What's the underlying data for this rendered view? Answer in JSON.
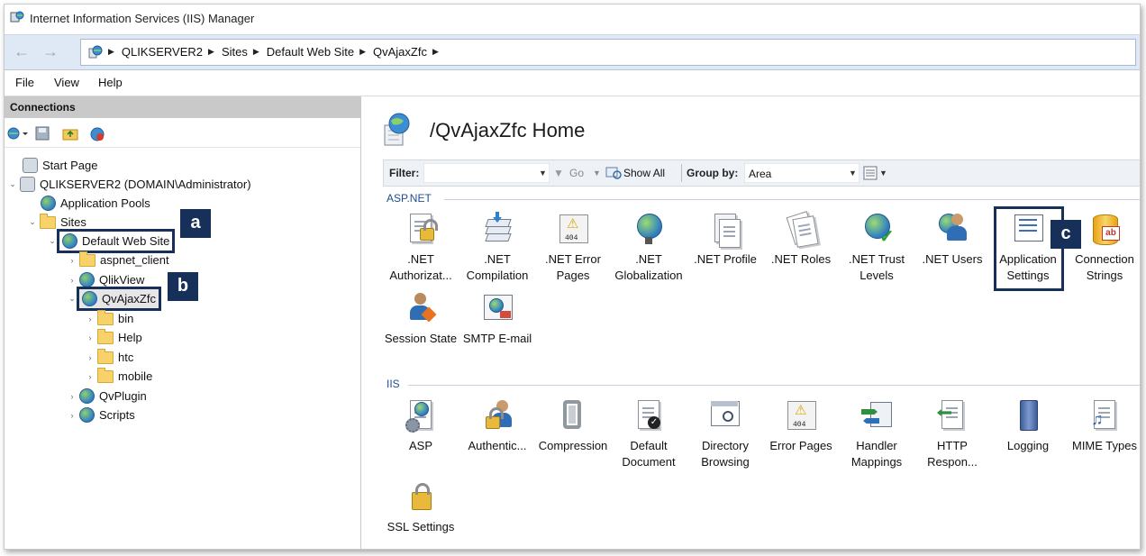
{
  "window": {
    "title": "Internet Information Services (IIS) Manager"
  },
  "address": {
    "crumbs": [
      "QLIKSERVER2",
      "Sites",
      "Default Web Site",
      "QvAjaxZfc"
    ]
  },
  "menu": [
    "File",
    "View",
    "Help"
  ],
  "connections": {
    "header": "Connections",
    "tree": {
      "start_page": "Start Page",
      "server": "QLIKSERVER2 (DOMAIN\\Administrator)",
      "app_pools": "Application Pools",
      "sites": "Sites",
      "default_site": "Default Web Site",
      "aspnet_client": "aspnet_client",
      "qlikview": "QlikView",
      "qvajaxzfc": "QvAjaxZfc",
      "bin": "bin",
      "help": "Help",
      "htc": "htc",
      "mobile": "mobile",
      "qvplugin": "QvPlugin",
      "scripts": "Scripts"
    }
  },
  "callouts": {
    "a": "a",
    "b": "b",
    "c": "c"
  },
  "home": {
    "title": "/QvAjaxZfc Home",
    "filter_label": "Filter:",
    "go_label": "Go",
    "show_all_label": "Show All",
    "group_by_label": "Group by:",
    "group_by_value": "Area"
  },
  "sections": {
    "aspnet": {
      "label": "ASP.NET",
      "features": [
        {
          "l1": ".NET",
          "l2": "Authorizat..."
        },
        {
          "l1": ".NET",
          "l2": "Compilation"
        },
        {
          "l1": ".NET Error",
          "l2": "Pages"
        },
        {
          "l1": ".NET",
          "l2": "Globalization"
        },
        {
          "l1": ".NET Profile",
          "l2": ""
        },
        {
          "l1": ".NET Roles",
          "l2": ""
        },
        {
          "l1": ".NET Trust",
          "l2": "Levels"
        },
        {
          "l1": ".NET Users",
          "l2": ""
        },
        {
          "l1": "Application",
          "l2": "Settings"
        },
        {
          "l1": "Connection",
          "l2": "Strings"
        },
        {
          "l1": "Session State",
          "l2": ""
        },
        {
          "l1": "SMTP E-mail",
          "l2": ""
        }
      ]
    },
    "iis": {
      "label": "IIS",
      "features": [
        {
          "l1": "ASP",
          "l2": ""
        },
        {
          "l1": "Authentic...",
          "l2": ""
        },
        {
          "l1": "Compression",
          "l2": ""
        },
        {
          "l1": "Default",
          "l2": "Document"
        },
        {
          "l1": "Directory",
          "l2": "Browsing"
        },
        {
          "l1": "Error Pages",
          "l2": ""
        },
        {
          "l1": "Handler",
          "l2": "Mappings"
        },
        {
          "l1": "HTTP",
          "l2": "Respon..."
        },
        {
          "l1": "Logging",
          "l2": ""
        },
        {
          "l1": "MIME Types",
          "l2": ""
        },
        {
          "l1": "SSL Settings",
          "l2": ""
        }
      ]
    }
  }
}
